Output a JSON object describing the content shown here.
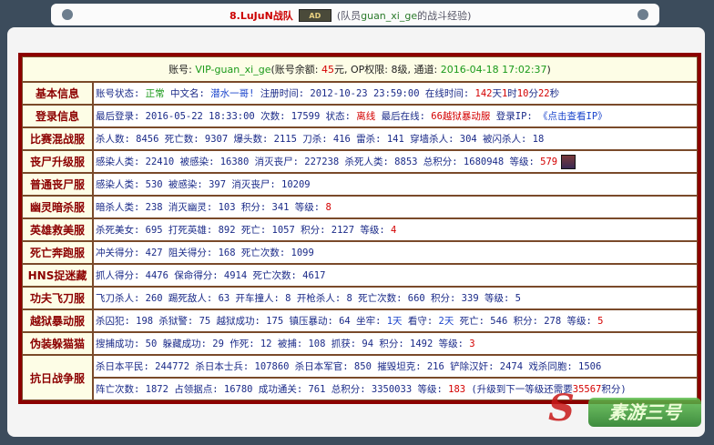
{
  "header": {
    "name": "8.LuJuN",
    "team": "战队",
    "badge": "AD",
    "desc_prefix": "(队员",
    "member": "guan_xi_ge",
    "desc_suffix": "的战斗经验)"
  },
  "account": {
    "text1": "账号: ",
    "id": "VIP-guan_xi_ge",
    "text2": "(账号余额: ",
    "balance": "45",
    "text3": "元, OP权限: ",
    "op": "8",
    "text4": "级, 通道: ",
    "date": "2016-04-18 17:02:37",
    "text5": ")"
  },
  "rows": [
    {
      "label": "基本信息",
      "parts": [
        {
          "t": "账号状态: ",
          "c": "v"
        },
        {
          "t": "正常",
          "c": "grn"
        },
        {
          "t": "  中文名: ",
          "c": "v"
        },
        {
          "t": "潜水一哥!",
          "c": "blu"
        },
        {
          "t": "  注册时间: 2012-10-23 23:59:00  在线时间: ",
          "c": "v"
        },
        {
          "t": "142",
          "c": "red"
        },
        {
          "t": "天",
          "c": "v"
        },
        {
          "t": "1",
          "c": "red"
        },
        {
          "t": "时",
          "c": "v"
        },
        {
          "t": "10",
          "c": "red"
        },
        {
          "t": "分",
          "c": "v"
        },
        {
          "t": "22",
          "c": "red"
        },
        {
          "t": "秒",
          "c": "v"
        }
      ]
    },
    {
      "label": "登录信息",
      "parts": [
        {
          "t": "最后登录: 2016-05-22 18:33:00  次数: 17599  状态: ",
          "c": "v"
        },
        {
          "t": "离线",
          "c": "red"
        },
        {
          "t": "  最后在线: ",
          "c": "v"
        },
        {
          "t": "66越狱暴动服",
          "c": "red"
        },
        {
          "t": "  登录IP: ",
          "c": "v"
        },
        {
          "t": "《点击查看IP》",
          "c": "blu"
        }
      ]
    },
    {
      "label": "比赛混战服",
      "parts": [
        {
          "t": "杀人数: 8456  死亡数: 9307  爆头数: 2115  刀杀: 416  雷杀: 141  穿墙杀人: 304  被闪杀人: 18",
          "c": "v"
        }
      ]
    },
    {
      "label": "丧尸升级服",
      "parts": [
        {
          "t": "感染人类: 22410  被感染: 16380  消灭丧尸: 227238  杀死人类: 8853  总积分: 1680948  等级: ",
          "c": "v"
        },
        {
          "t": "579",
          "c": "red"
        }
      ],
      "icon": "rank-icon"
    },
    {
      "label": "普通丧尸服",
      "parts": [
        {
          "t": "感染人类: 530  被感染: 397  消灭丧尸: 10209",
          "c": "v"
        }
      ]
    },
    {
      "label": "幽灵暗杀服",
      "parts": [
        {
          "t": "暗杀人类: 238  消灭幽灵: 103  积分: 341  等级: ",
          "c": "v"
        },
        {
          "t": "8",
          "c": "red"
        }
      ]
    },
    {
      "label": "英雄救美服",
      "parts": [
        {
          "t": "杀死美女: 695  打死英雄: 892  死亡: 1057  积分: 2127  等级: ",
          "c": "v"
        },
        {
          "t": "4",
          "c": "red"
        }
      ]
    },
    {
      "label": "死亡奔跑服",
      "parts": [
        {
          "t": "冲关得分: 427  阻关得分: 168  死亡次数: 1099",
          "c": "v"
        }
      ]
    },
    {
      "label": "HNS捉迷藏",
      "parts": [
        {
          "t": "抓人得分: 4476  保命得分: 4914  死亡次数: 4617",
          "c": "v"
        }
      ]
    },
    {
      "label": "功夫飞刀服",
      "parts": [
        {
          "t": "飞刀杀人: 260  踢死敌人: 63  开车撞人: 8  开枪杀人: 8  死亡次数: 660  积分: 339  等级: 5",
          "c": "v"
        }
      ]
    },
    {
      "label": "越狱暴动服",
      "parts": [
        {
          "t": "杀囚犯: 198  杀狱警: 75  越狱成功: 175  镇压暴动: 64  坐牢: ",
          "c": "v"
        },
        {
          "t": "1天",
          "c": "blu"
        },
        {
          "t": "  看守: ",
          "c": "v"
        },
        {
          "t": "2天",
          "c": "blu"
        },
        {
          "t": "  死亡: 546  积分: 278  等级: ",
          "c": "v"
        },
        {
          "t": "5",
          "c": "red"
        }
      ]
    },
    {
      "label": "伪装躲猫猫",
      "parts": [
        {
          "t": "搜捕成功: 50  躲藏成功: 29  作死: 12  被捕: 108  抓获: 94  积分: 1492  等级: ",
          "c": "v"
        },
        {
          "t": "3",
          "c": "red"
        }
      ]
    },
    {
      "label": "抗日战争服",
      "double": true,
      "parts": [
        {
          "t": "杀日本平民: 244772  杀日本士兵: 107860  杀日本军官: 850  摧毁坦克: 216  铲除汉奸: 2474  戏杀同胞: 1506",
          "c": "v"
        }
      ],
      "parts2": [
        {
          "t": "阵亡次数: 1872  占领据点: 16780  成功通关: 761  总积分: 3350033  等级: ",
          "c": "v"
        },
        {
          "t": "183",
          "c": "red"
        },
        {
          "t": "  (升级到下一等级还需要",
          "c": "v"
        },
        {
          "t": "35567",
          "c": "red"
        },
        {
          "t": "积分)",
          "c": "v"
        }
      ]
    }
  ],
  "watermark": {
    "mark": "S",
    "text": "素游三号"
  },
  "colors": {
    "border": "#8c0000",
    "label": "#8c0000",
    "value": "#1a2a88",
    "highlight": "#d40000",
    "status_ok": "#1a9a1a"
  }
}
